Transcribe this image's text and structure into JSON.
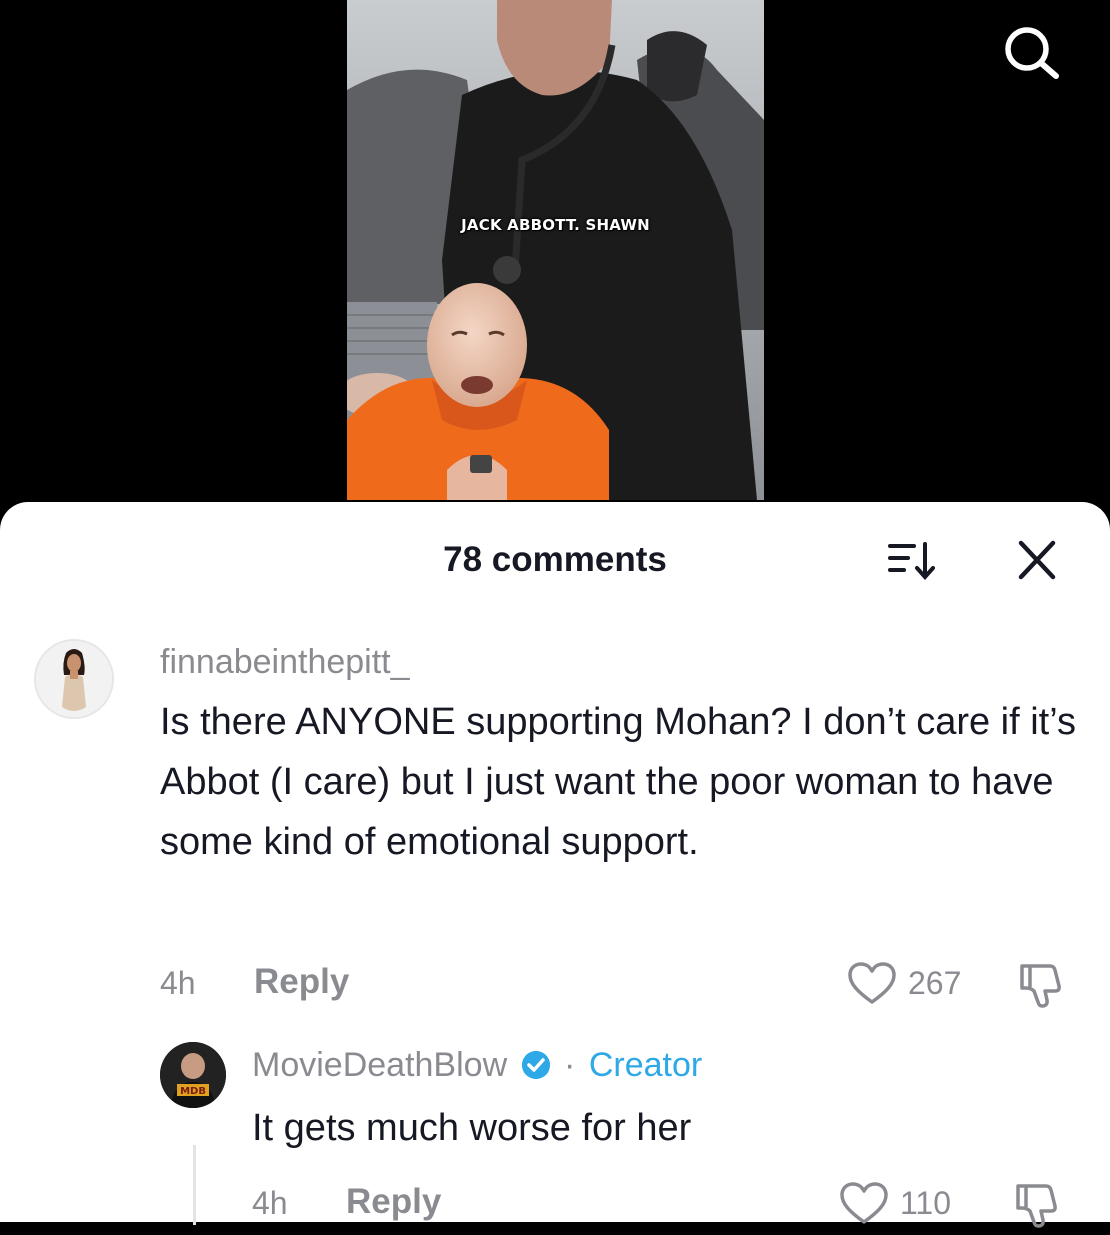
{
  "video": {
    "caption": "JACK ABBOTT. SHAWN"
  },
  "icons": {
    "search": "search-icon",
    "sort": "sort-icon",
    "close": "close-icon",
    "like": "heart-icon",
    "dislike": "dislike-icon",
    "verified": "verified-badge-icon"
  },
  "comments_sheet": {
    "title": "78 comments"
  },
  "comments": [
    {
      "username": "finnabeinthepitt_",
      "text": "Is there ANYONE supporting Mohan? I don’t care if it’s Abbot (I care) but I just want the poor woman to have some kind of emotional support.",
      "time": "4h",
      "reply_label": "Reply",
      "likes": "267"
    }
  ],
  "reply": {
    "username": "MovieDeathBlow",
    "separator": "·",
    "creator_label": "Creator",
    "text": "It gets much worse for her",
    "time": "4h",
    "reply_label": "Reply",
    "likes": "110"
  },
  "colors": {
    "accent": "#2ea8e6",
    "text": "#161823",
    "muted": "#8a8b91"
  }
}
